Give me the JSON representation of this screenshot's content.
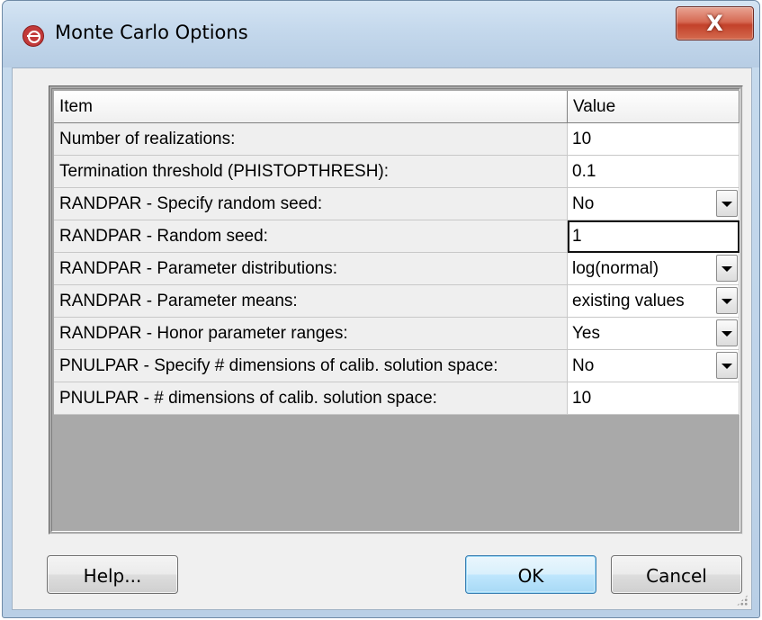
{
  "window": {
    "title": "Monte Carlo Options",
    "close_label": "X"
  },
  "grid": {
    "headers": [
      "Item",
      "Value"
    ],
    "rows": [
      {
        "label": "Number of realizations:",
        "value": "10"
      },
      {
        "label": "Termination threshold (PHISTOPTHRESH):",
        "value": "0.1"
      },
      {
        "label": "RANDPAR - Specify random seed:",
        "value": "No"
      },
      {
        "label": "RANDPAR - Random seed:",
        "value": "1"
      },
      {
        "label": "RANDPAR - Parameter distributions:",
        "value": "log(normal)"
      },
      {
        "label": "RANDPAR - Parameter means:",
        "value": "existing values"
      },
      {
        "label": "RANDPAR - Honor parameter ranges:",
        "value": "Yes"
      },
      {
        "label": "PNULPAR - Specify # dimensions of calib. solution space:",
        "value": "No"
      },
      {
        "label": "PNULPAR - # dimensions of calib. solution space:",
        "value": "10"
      }
    ]
  },
  "buttons": {
    "help": "Help...",
    "ok": "OK",
    "cancel": "Cancel"
  },
  "icons": {
    "app": "gms-logo-icon",
    "dropdown": "chevron-down-icon",
    "grip": "resize-grip-icon"
  },
  "colors": {
    "close_button": "#c3412a",
    "grid_background": "#a9a9a9",
    "default_button_border": "#3c7fb1"
  }
}
